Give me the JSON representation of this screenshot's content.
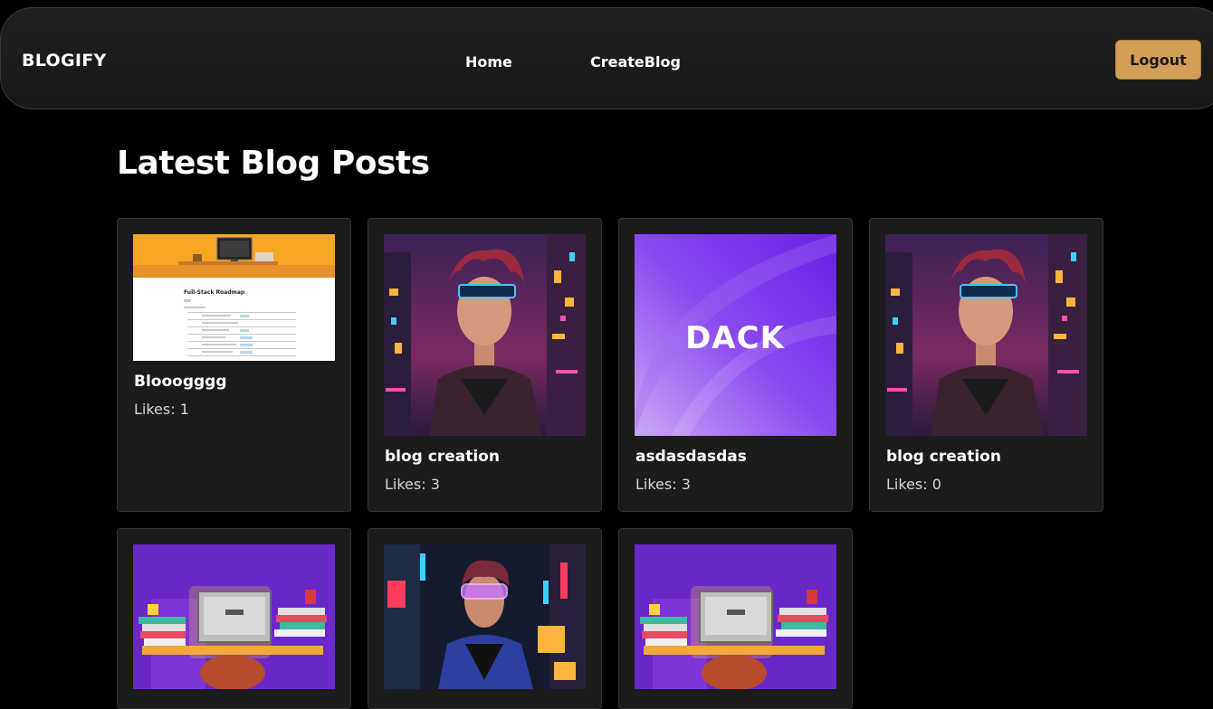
{
  "nav": {
    "brand": "BLOGIFY",
    "home": "Home",
    "create": "CreateBlog",
    "logout": "Logout"
  },
  "page": {
    "title": "Latest Blog Posts"
  },
  "likes_prefix": "Likes: ",
  "posts": [
    {
      "title": "Blooogggg",
      "likes": 1,
      "image": "roadmap",
      "image_text": "Full-Stack Roadmap"
    },
    {
      "title": "blog creation",
      "likes": 3,
      "image": "cyber-man"
    },
    {
      "title": "asdasdasdas",
      "likes": 3,
      "image": "dack",
      "image_text": "DACK"
    },
    {
      "title": "blog creation",
      "likes": 0,
      "image": "cyber-man"
    },
    {
      "title": "",
      "likes": null,
      "image": "desk"
    },
    {
      "title": "",
      "likes": null,
      "image": "goggles"
    },
    {
      "title": "",
      "likes": null,
      "image": "desk"
    }
  ],
  "colors": {
    "background": "#000000",
    "navbar": "#1c1c1c",
    "logout": "#d29e58",
    "card": "#1b1b1b"
  }
}
